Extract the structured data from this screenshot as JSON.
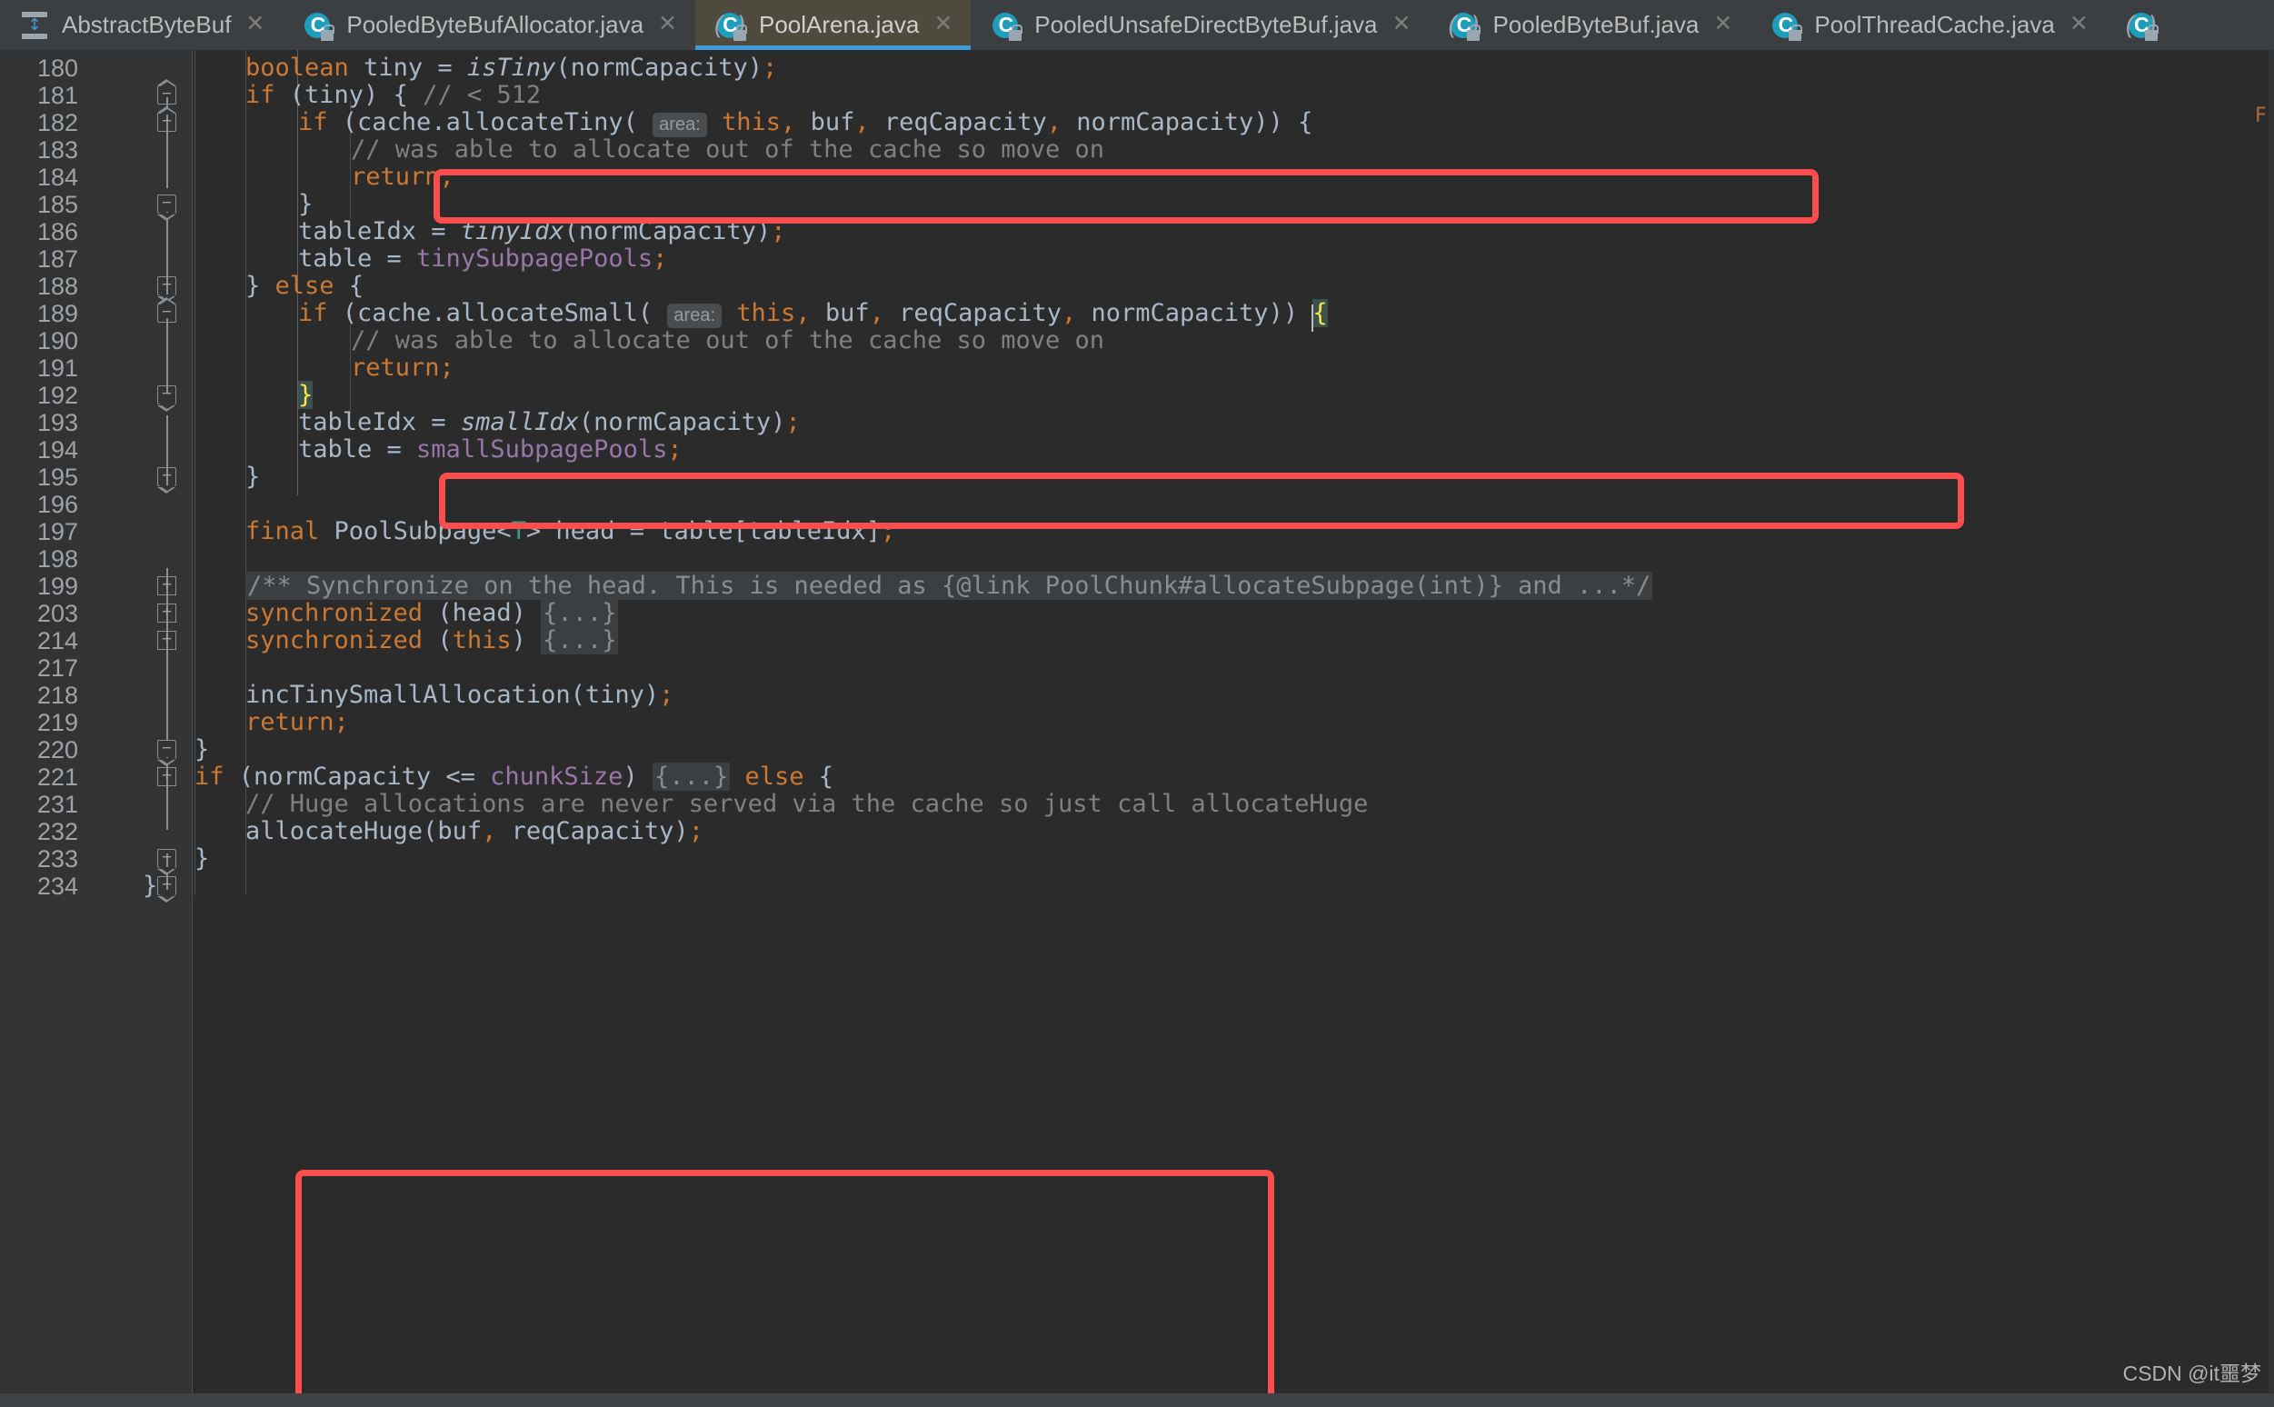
{
  "window": {
    "accent_blue": "#3d9ad6",
    "annotation_color": "#fa4d4d",
    "editor_bg": "#2b2b2b",
    "gutter_bg": "#313335",
    "tabbar_bg": "#3c3f41",
    "active_tab_bg": "#4e4a3e"
  },
  "tabs": [
    {
      "label": "AbstractByteBuf",
      "icon": "abstract-class-icon",
      "close": "✕",
      "active": false
    },
    {
      "label": "PooledByteBufAllocator.java",
      "icon": "java-class-icon",
      "close": "✕",
      "active": false
    },
    {
      "label": "PoolArena.java",
      "icon": "java-class-icon",
      "close": "✕",
      "active": true
    },
    {
      "label": "PooledUnsafeDirectByteBuf.java",
      "icon": "java-class-icon",
      "close": "✕",
      "active": false
    },
    {
      "label": "PooledByteBuf.java",
      "icon": "java-class-icon",
      "close": "✕",
      "active": false
    },
    {
      "label": "PoolThreadCache.java",
      "icon": "java-class-icon",
      "close": "✕",
      "active": false
    }
  ],
  "editor": {
    "line_numbers": [
      180,
      181,
      182,
      183,
      184,
      185,
      186,
      187,
      188,
      189,
      190,
      191,
      192,
      193,
      194,
      195,
      196,
      197,
      198,
      199,
      203,
      214,
      217,
      218,
      219,
      220,
      221,
      231,
      232,
      233,
      234
    ],
    "lines": [
      {
        "n": 180,
        "indent": 8,
        "text": "boolean tiny = isTiny(normCapacity);"
      },
      {
        "n": 181,
        "indent": 8,
        "text": "if (tiny) { // < 512"
      },
      {
        "n": 182,
        "indent": 12,
        "text": "if (cache.allocateTiny( area: this, buf, reqCapacity, normCapacity)) {"
      },
      {
        "n": 183,
        "indent": 16,
        "text": "// was able to allocate out of the cache so move on"
      },
      {
        "n": 184,
        "indent": 16,
        "text": "return;"
      },
      {
        "n": 185,
        "indent": 12,
        "text": "}"
      },
      {
        "n": 186,
        "indent": 12,
        "text": "tableIdx = tinyIdx(normCapacity);"
      },
      {
        "n": 187,
        "indent": 12,
        "text": "table = tinySubpagePools;"
      },
      {
        "n": 188,
        "indent": 8,
        "text": "} else {"
      },
      {
        "n": 189,
        "indent": 12,
        "text": "if (cache.allocateSmall( area: this, buf, reqCapacity, normCapacity)) {"
      },
      {
        "n": 190,
        "indent": 16,
        "text": "// was able to allocate out of the cache so move on"
      },
      {
        "n": 191,
        "indent": 16,
        "text": "return;"
      },
      {
        "n": 192,
        "indent": 12,
        "text": "}"
      },
      {
        "n": 193,
        "indent": 12,
        "text": "tableIdx = smallIdx(normCapacity);"
      },
      {
        "n": 194,
        "indent": 12,
        "text": "table = smallSubpagePools;"
      },
      {
        "n": 195,
        "indent": 8,
        "text": "}"
      },
      {
        "n": 196,
        "indent": 0,
        "text": ""
      },
      {
        "n": 197,
        "indent": 8,
        "text": "final PoolSubpage<T> head = table[tableIdx];"
      },
      {
        "n": 198,
        "indent": 0,
        "text": ""
      },
      {
        "n": 199,
        "indent": 8,
        "text": "/** Synchronize on the head. This is needed as {@link PoolChunk#allocateSubpage(int)} and ...*/"
      },
      {
        "n": 203,
        "indent": 8,
        "text": "synchronized (head) {...}"
      },
      {
        "n": 214,
        "indent": 8,
        "text": "synchronized (this) {...}"
      },
      {
        "n": 217,
        "indent": 0,
        "text": ""
      },
      {
        "n": 218,
        "indent": 8,
        "text": "incTinySmallAllocation(tiny);"
      },
      {
        "n": 219,
        "indent": 8,
        "text": "return;"
      },
      {
        "n": 220,
        "indent": 4,
        "text": "}"
      },
      {
        "n": 221,
        "indent": 4,
        "text": "if (normCapacity <= chunkSize) {...} else {"
      },
      {
        "n": 231,
        "indent": 8,
        "text": "// Huge allocations are never served via the cache so just call allocateHuge"
      },
      {
        "n": 232,
        "indent": 8,
        "text": "allocateHuge(buf, reqCapacity);"
      },
      {
        "n": 233,
        "indent": 4,
        "text": "}"
      },
      {
        "n": 234,
        "indent": 0,
        "text": "}"
      }
    ],
    "fold_markers": [
      {
        "line": 181,
        "kind": "region-start",
        "sign": "−"
      },
      {
        "line": 182,
        "kind": "region-start",
        "sign": "−"
      },
      {
        "line": 185,
        "kind": "region-end",
        "sign": "−"
      },
      {
        "line": 188,
        "kind": "region-end",
        "sign": "−"
      },
      {
        "line": 189,
        "kind": "region-start",
        "sign": "−"
      },
      {
        "line": 192,
        "kind": "region-end",
        "sign": "−"
      },
      {
        "line": 195,
        "kind": "region-end",
        "sign": "−"
      },
      {
        "line": 199,
        "kind": "collapsed",
        "sign": "+"
      },
      {
        "line": 203,
        "kind": "collapsed",
        "sign": "+"
      },
      {
        "line": 214,
        "kind": "collapsed",
        "sign": "+"
      },
      {
        "line": 220,
        "kind": "region-end",
        "sign": "−"
      },
      {
        "line": 221,
        "kind": "collapsed",
        "sign": "+"
      },
      {
        "line": 233,
        "kind": "region-end",
        "sign": "−"
      },
      {
        "line": 234,
        "kind": "region-end",
        "sign": "−"
      }
    ],
    "annotations": [
      {
        "name": "highlight-allocate-tiny",
        "target_line": 182
      },
      {
        "name": "highlight-allocate-small",
        "target_line": 189
      },
      {
        "name": "highlight-allocate-huge",
        "target_lines": "221-233"
      }
    ],
    "matching_brace": {
      "open_line": 189,
      "close_line": 192,
      "glyph_open": "{",
      "glyph_close": "}"
    },
    "parameter_hint": "area:",
    "folded_placeholder": "{...}"
  },
  "watermark": {
    "text": "CSDN @it噩梦"
  }
}
